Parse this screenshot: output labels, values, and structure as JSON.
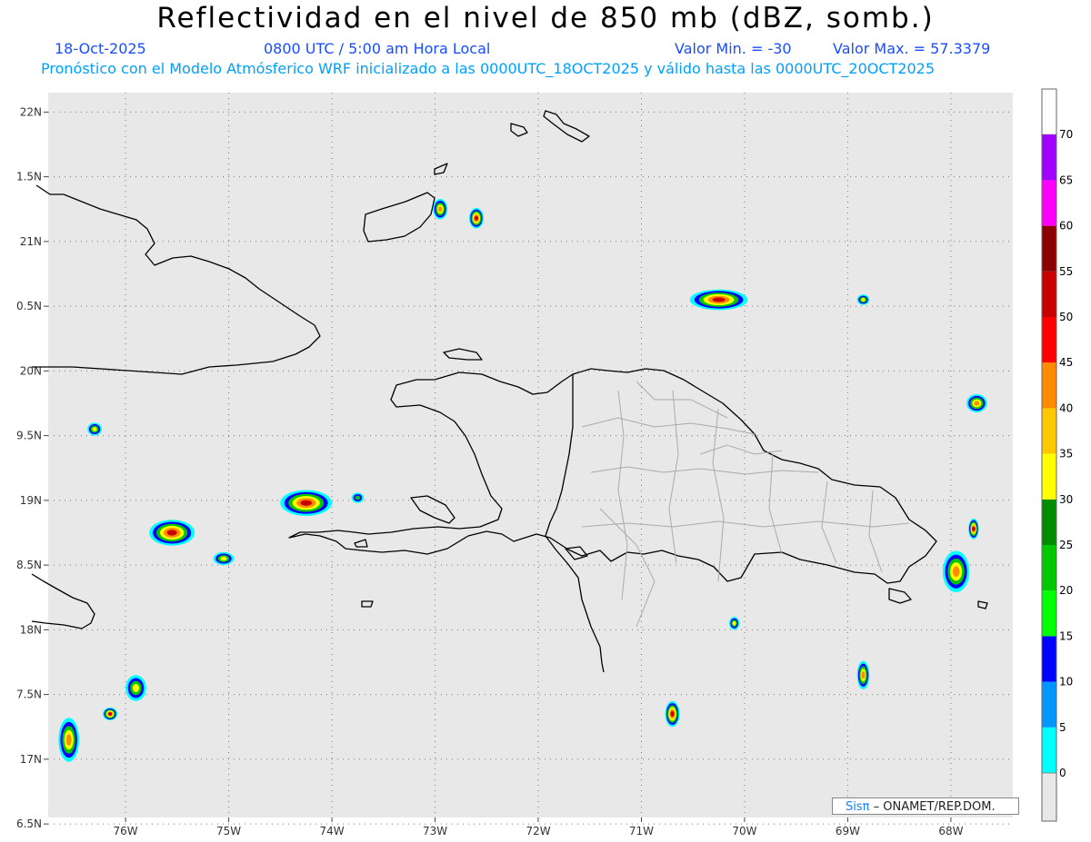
{
  "header": {
    "title": "Reflectividad en el nivel de 850 mb (dBZ, somb.)",
    "date": "18-Oct-2025",
    "time": "0800 UTC / 5:00 am Hora Local",
    "min_label": "Valor Min. = -30",
    "max_label": "Valor Max. = 57.3379",
    "description": "Pronóstico con el Modelo Atmósferico WRF inicializado a las 0000UTC_18OCT2025 y válido hasta las  0000UTC_20OCT2025"
  },
  "map": {
    "lon_range": [
      -76.75,
      -67.4
    ],
    "lat_range": [
      16.55,
      22.15
    ],
    "lon_ticks": [
      {
        "value": -76,
        "label": "76W"
      },
      {
        "value": -75,
        "label": "75W"
      },
      {
        "value": -74,
        "label": "74W"
      },
      {
        "value": -73,
        "label": "73W"
      },
      {
        "value": -72,
        "label": "72W"
      },
      {
        "value": -71,
        "label": "71W"
      },
      {
        "value": -70,
        "label": "70W"
      },
      {
        "value": -69,
        "label": "69W"
      },
      {
        "value": -68,
        "label": "68W"
      }
    ],
    "lat_ticks": [
      {
        "value": 22,
        "label": "22N"
      },
      {
        "value": 21.5,
        "label": "1.5N"
      },
      {
        "value": 21,
        "label": "21N"
      },
      {
        "value": 20.5,
        "label": "0.5N"
      },
      {
        "value": 20,
        "label": "20N"
      },
      {
        "value": 19.5,
        "label": "9.5N"
      },
      {
        "value": 19,
        "label": "19N"
      },
      {
        "value": 18.5,
        "label": "8.5N"
      },
      {
        "value": 18,
        "label": "18N"
      },
      {
        "value": 17.5,
        "label": "7.5N"
      },
      {
        "value": 17,
        "label": "17N"
      },
      {
        "value": 16.5,
        "label": "6.5N"
      }
    ],
    "ocean_color": "#e8e8e8",
    "coast_color": "#000000",
    "province_color": "#aaaaaa"
  },
  "colorbar": {
    "levels": [
      {
        "label": "0",
        "color": "#00ffff"
      },
      {
        "label": "5",
        "color": "#0096ff"
      },
      {
        "label": "10",
        "color": "#0000ff"
      },
      {
        "label": "15",
        "color": "#00ff00"
      },
      {
        "label": "20",
        "color": "#00c800"
      },
      {
        "label": "25",
        "color": "#008c00"
      },
      {
        "label": "30",
        "color": "#ffff00"
      },
      {
        "label": "35",
        "color": "#ffc800"
      },
      {
        "label": "40",
        "color": "#ff8c00"
      },
      {
        "label": "45",
        "color": "#ff0000"
      },
      {
        "label": "50",
        "color": "#c80000"
      },
      {
        "label": "55",
        "color": "#8c0000"
      },
      {
        "label": "60",
        "color": "#ff00ff"
      },
      {
        "label": "65",
        "color": "#a000ff"
      },
      {
        "label": "70",
        "color": "#ffffff"
      }
    ],
    "below_color": "#e8e8e8"
  },
  "cells": [
    {
      "lon": -75.55,
      "lat": 18.75,
      "rx": 0.22,
      "ry": 0.1,
      "max": 50
    },
    {
      "lon": -75.05,
      "lat": 18.55,
      "rx": 0.1,
      "ry": 0.05,
      "max": 30
    },
    {
      "lon": -74.25,
      "lat": 18.98,
      "rx": 0.25,
      "ry": 0.1,
      "max": 50
    },
    {
      "lon": -73.75,
      "lat": 19.02,
      "rx": 0.06,
      "ry": 0.04,
      "max": 20
    },
    {
      "lon": -75.9,
      "lat": 17.55,
      "rx": 0.1,
      "ry": 0.1,
      "max": 35
    },
    {
      "lon": -76.55,
      "lat": 17.15,
      "rx": 0.1,
      "ry": 0.17,
      "max": 40
    },
    {
      "lon": -76.15,
      "lat": 17.35,
      "rx": 0.07,
      "ry": 0.05,
      "max": 50
    },
    {
      "lon": -76.3,
      "lat": 19.55,
      "rx": 0.07,
      "ry": 0.05,
      "max": 30
    },
    {
      "lon": -72.95,
      "lat": 21.25,
      "rx": 0.07,
      "ry": 0.08,
      "max": 40
    },
    {
      "lon": -72.6,
      "lat": 21.18,
      "rx": 0.07,
      "ry": 0.08,
      "max": 50
    },
    {
      "lon": -70.25,
      "lat": 20.55,
      "rx": 0.28,
      "ry": 0.08,
      "max": 50
    },
    {
      "lon": -67.75,
      "lat": 19.75,
      "rx": 0.1,
      "ry": 0.07,
      "max": 40
    },
    {
      "lon": -67.95,
      "lat": 18.45,
      "rx": 0.13,
      "ry": 0.16,
      "max": 40
    },
    {
      "lon": -67.78,
      "lat": 18.78,
      "rx": 0.05,
      "ry": 0.08,
      "max": 50
    },
    {
      "lon": -68.85,
      "lat": 17.65,
      "rx": 0.06,
      "ry": 0.11,
      "max": 40
    },
    {
      "lon": -70.7,
      "lat": 17.35,
      "rx": 0.07,
      "ry": 0.1,
      "max": 50
    },
    {
      "lon": -70.1,
      "lat": 18.05,
      "rx": 0.05,
      "ry": 0.05,
      "max": 30
    },
    {
      "lon": -68.85,
      "lat": 20.55,
      "rx": 0.06,
      "ry": 0.04,
      "max": 35
    }
  ],
  "credit": {
    "brand": "Sisπ",
    "text": " – ONAMET/REP.DOM."
  }
}
